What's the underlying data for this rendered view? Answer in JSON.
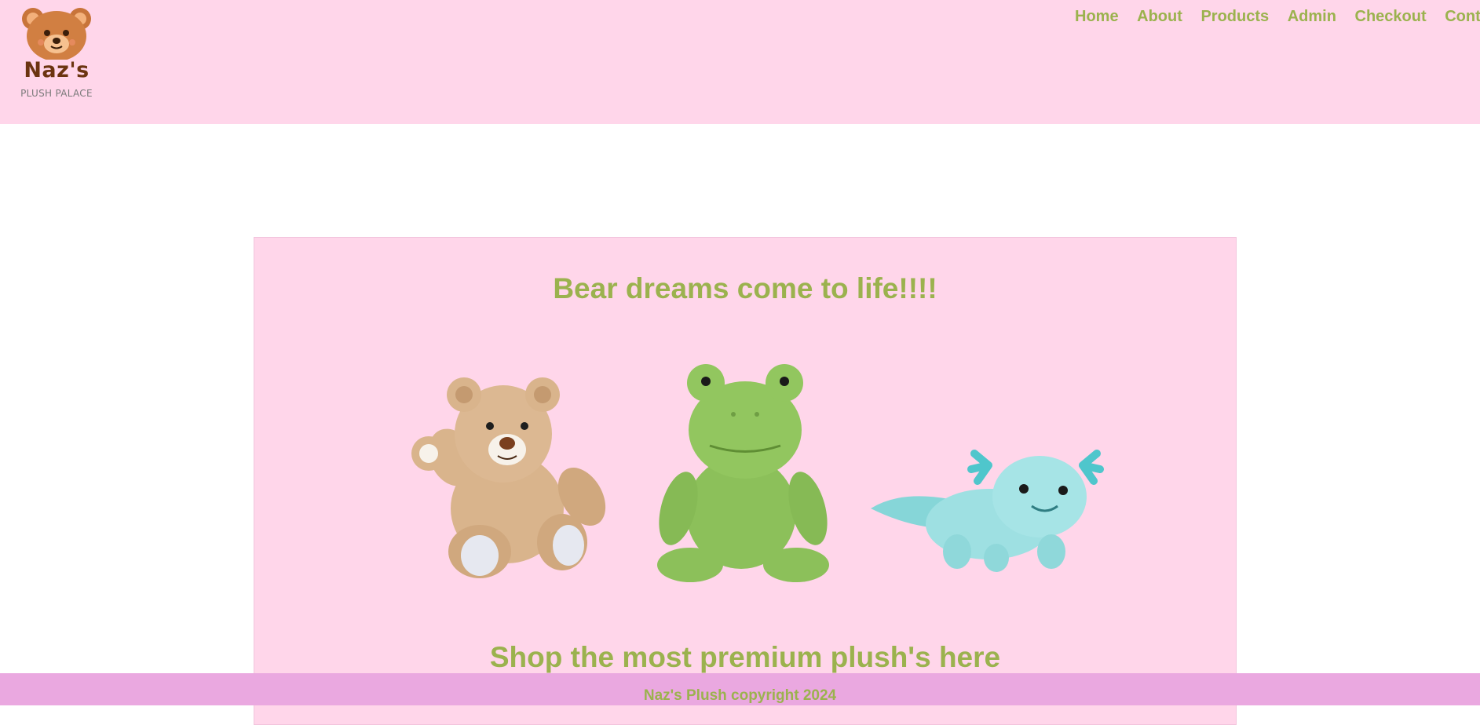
{
  "brand": {
    "name": "Naz's",
    "tagline": "PLUSH PALACE"
  },
  "nav": {
    "items": [
      "Home",
      "About",
      "Products",
      "Admin",
      "Checkout",
      "Contact"
    ]
  },
  "hero": {
    "heading": "Bear dreams come to life!!!!",
    "subheading": "Shop the most premium plush's here",
    "images": [
      "teddy-bear-plush",
      "green-frog-plush",
      "blue-axolotl-plush"
    ]
  },
  "footer": {
    "copyright": "Naz's Plush copyright 2024"
  },
  "colors": {
    "header_bg": "#ffd6ea",
    "accent_text": "#9bb24e",
    "footer_bg": "#eaa8e0"
  }
}
